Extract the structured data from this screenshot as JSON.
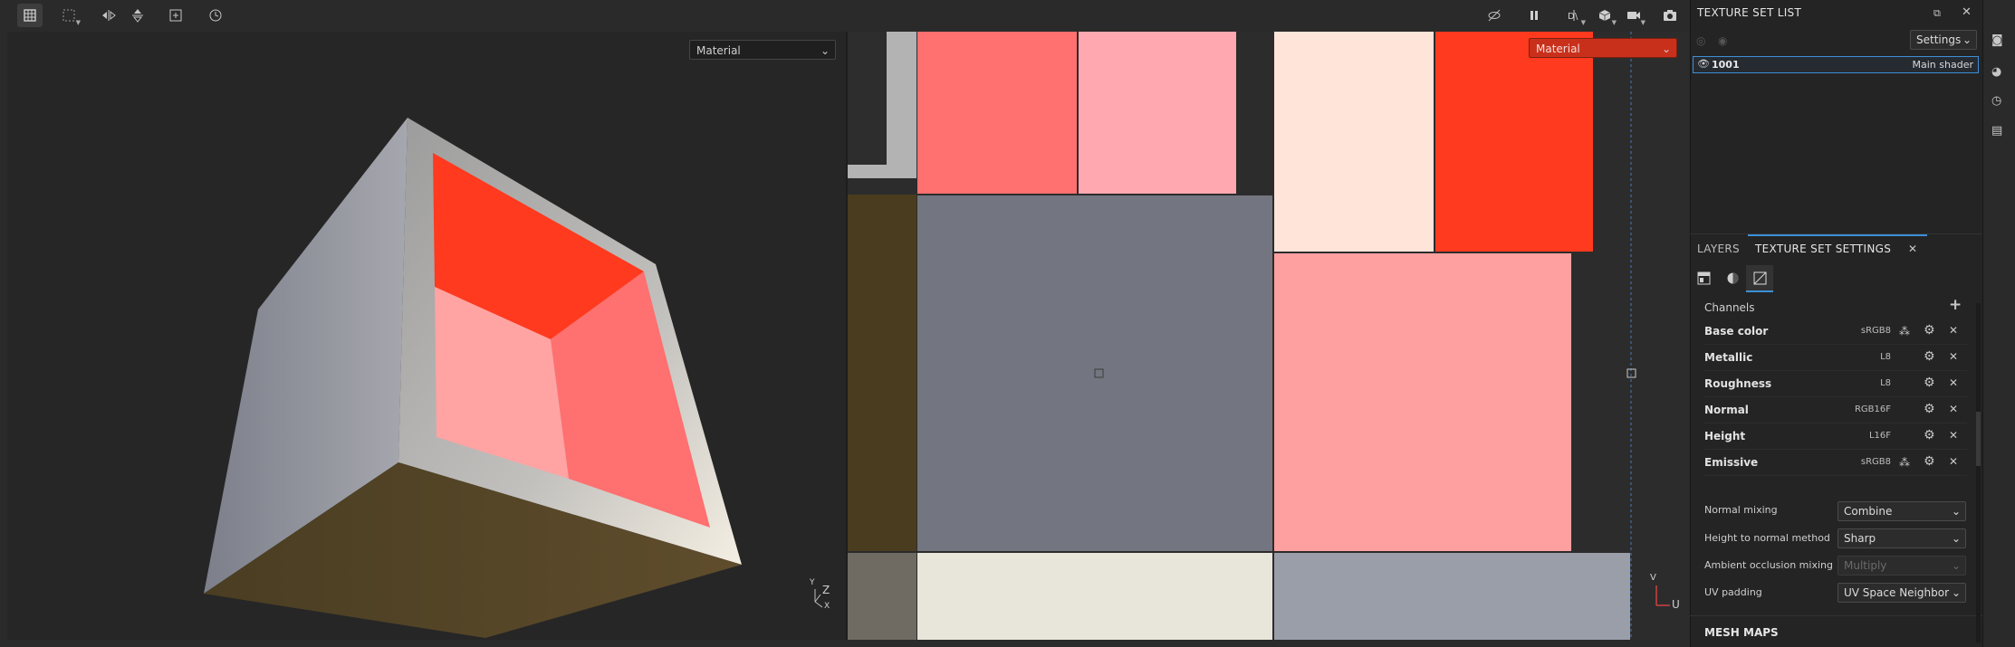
{
  "toolbar": {
    "left_tools": [
      "select-tool",
      "selection-mode-tool",
      "mirror-x-tool",
      "mirror-y-tool",
      "add-tool",
      "history-tool"
    ],
    "right_tools": [
      "hide-icon",
      "pause-icon",
      "camera-icon",
      "capture-icon"
    ]
  },
  "viewport3d": {
    "mode_select": "Material",
    "axis_labels": {
      "x": "X",
      "y": "Y",
      "z": "Z"
    }
  },
  "viewport2d": {
    "mode_select": "Material",
    "axis_labels": {
      "v": "V",
      "u": "U"
    }
  },
  "texture_set_list": {
    "title": "TEXTURE SET LIST",
    "settings_label": "Settings",
    "item": {
      "name": "1001",
      "shader": "Main shader"
    }
  },
  "tabs": {
    "layers": "LAYERS",
    "texture_set_settings": "TEXTURE SET SETTINGS"
  },
  "channels": {
    "title": "Channels",
    "items": [
      {
        "name": "Base color",
        "format": "sRGB8"
      },
      {
        "name": "Metallic",
        "format": "L8"
      },
      {
        "name": "Roughness",
        "format": "L8"
      },
      {
        "name": "Normal",
        "format": "RGB16F"
      },
      {
        "name": "Height",
        "format": "L16F"
      },
      {
        "name": "Emissive",
        "format": "sRGB8"
      }
    ]
  },
  "settings": {
    "normal_mixing": {
      "label": "Normal mixing",
      "value": "Combine"
    },
    "height_to_normal": {
      "label": "Height to normal method",
      "value": "Sharp"
    },
    "ao_mixing": {
      "label": "Ambient occlusion mixing",
      "value": "Multiply"
    },
    "uv_padding": {
      "label": "UV padding",
      "value": "UV Space Neighbor"
    }
  },
  "mesh_maps": {
    "title": "MESH MAPS"
  },
  "colors": {
    "red": "#ff3a1f",
    "salmon": "#ff7070",
    "pink": "#ffa0a0",
    "light_pink": "#ffe4da",
    "gray_slate": "#737680",
    "olive": "#4a3c1f",
    "cream": "#e8e5da",
    "gray_blue": "#9a9ea8",
    "accent": "#3d8fd6"
  }
}
